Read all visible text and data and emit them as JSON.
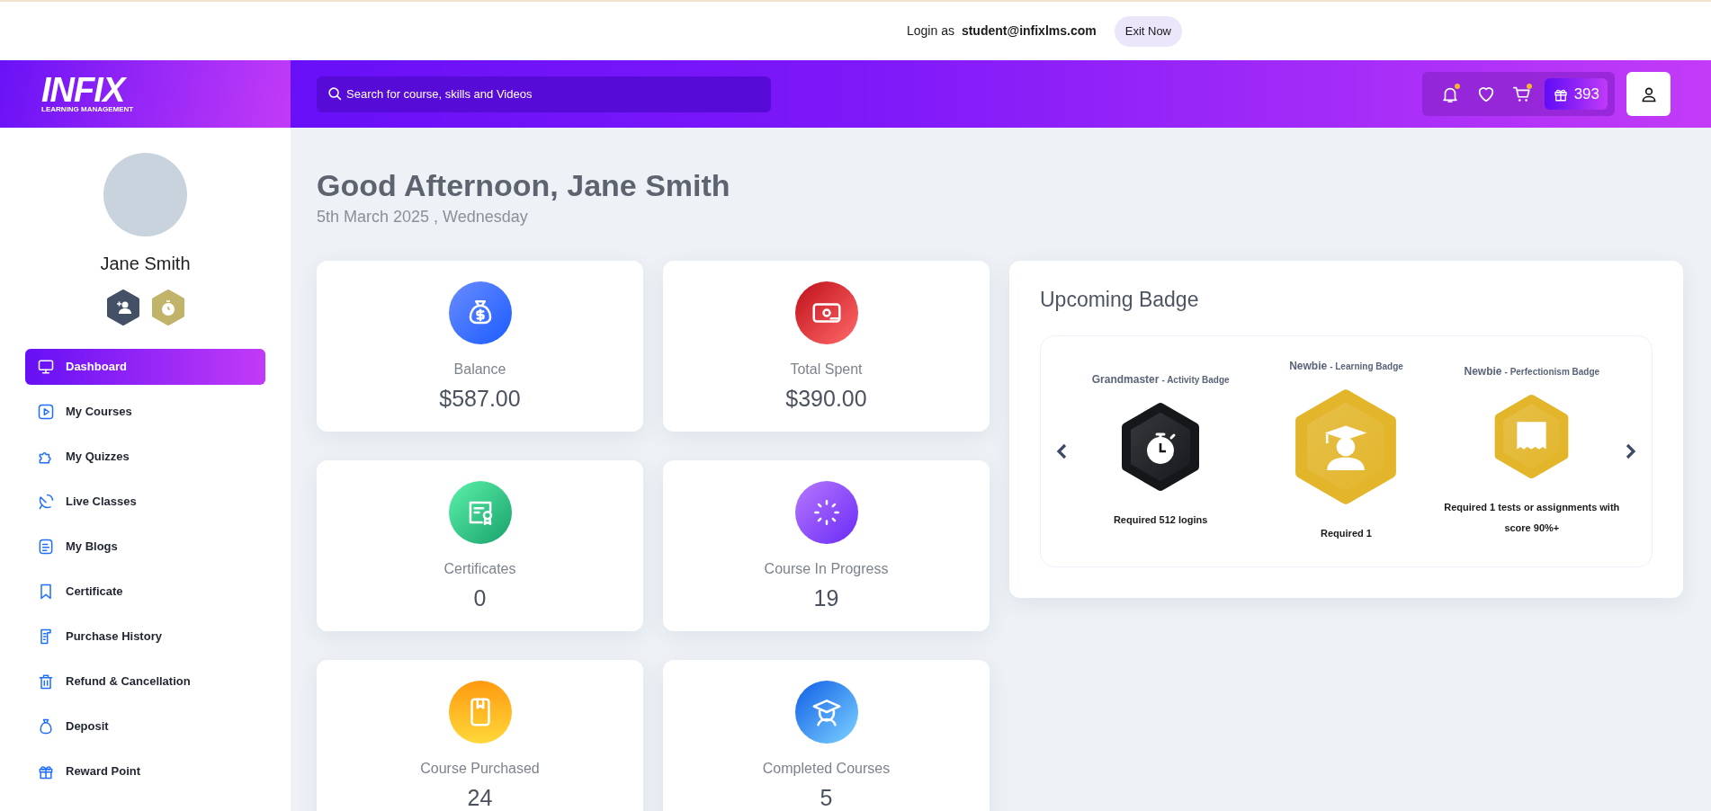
{
  "top_bar": {
    "login_label": "Login as",
    "email": "student@infixlms.com",
    "exit_button": "Exit Now"
  },
  "header": {
    "logo": {
      "wordmark": "INFIX",
      "tagline": "LEARNING MANAGEMENT"
    },
    "search": {
      "placeholder": "Search for course, skills and Videos"
    },
    "icons": [
      {
        "kind": "bell",
        "dot": true
      },
      {
        "kind": "heart",
        "dot": false
      },
      {
        "kind": "cart",
        "dot": true
      }
    ],
    "points": "393"
  },
  "sidebar": {
    "user_name": "Jane Smith",
    "items": [
      {
        "label": "Dashboard",
        "kind": "monitor",
        "selected": true
      },
      {
        "label": "My Courses",
        "kind": "play",
        "selected": false
      },
      {
        "label": "My Quizzes",
        "kind": "puzzle",
        "selected": false
      },
      {
        "label": "Live Classes",
        "kind": "satellite",
        "selected": false
      },
      {
        "label": "My Blogs",
        "kind": "note",
        "selected": false
      },
      {
        "label": "Certificate",
        "kind": "bookmark",
        "selected": false
      },
      {
        "label": "Purchase History",
        "kind": "receipt",
        "selected": false
      },
      {
        "label": "Refund & Cancellation",
        "kind": "trash",
        "selected": false
      },
      {
        "label": "Deposit",
        "kind": "bag",
        "selected": false
      },
      {
        "label": "Reward Point",
        "kind": "gift",
        "selected": false
      }
    ]
  },
  "greeting": {
    "title": "Good Afternoon, Jane Smith",
    "date": "5th March 2025 , Wednesday"
  },
  "stats": [
    {
      "label": "Balance",
      "value": "$587.00",
      "kind": "balance"
    },
    {
      "label": "Total Spent",
      "value": "$390.00",
      "kind": "spent"
    },
    {
      "label": "Certificates",
      "value": "0",
      "kind": "certificate"
    },
    {
      "label": "Course In Progress",
      "value": "19",
      "kind": "progress"
    },
    {
      "label": "Course Purchased",
      "value": "24",
      "kind": "purchased"
    },
    {
      "label": "Completed Courses",
      "value": "5",
      "kind": "completed"
    }
  ],
  "upcoming_badge": {
    "title": "Upcoming Badge",
    "badges": [
      {
        "name": "Grandmaster",
        "type": "- Activity Badge",
        "requirement": "Required 512 logins",
        "kind": "stopwatch",
        "color": "#15171b"
      },
      {
        "name": "Newbie",
        "type": "- Learning Badge",
        "requirement": "Required 1",
        "kind": "graduate",
        "color": "#e2b52a"
      },
      {
        "name": "Newbie",
        "type": "- Perfectionism Badge",
        "requirement": "Required 1 tests or assignments with score 90%+",
        "kind": "grade",
        "color": "#e2b52a"
      }
    ]
  }
}
